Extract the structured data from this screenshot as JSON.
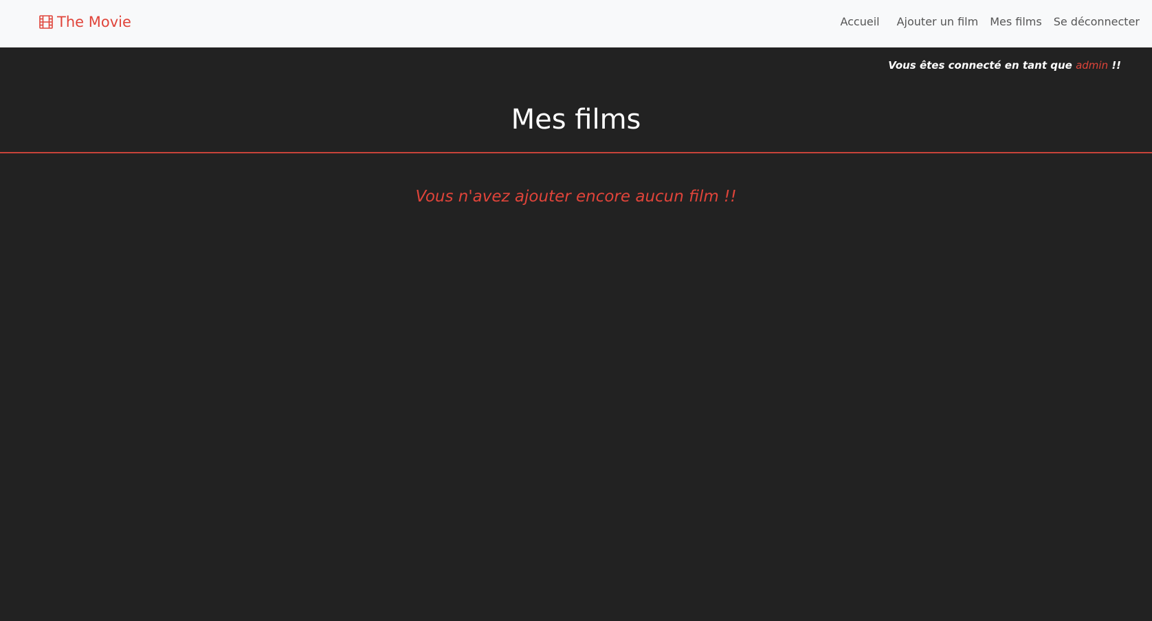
{
  "navbar": {
    "brand": {
      "icon": "film-icon",
      "label": "The Movie"
    },
    "links": [
      {
        "label": "Accueil"
      },
      {
        "label": "Ajouter un film"
      },
      {
        "label": "Mes films"
      },
      {
        "label": "Se déconnecter"
      }
    ]
  },
  "user_status": {
    "prefix": "Vous êtes connecté en tant que",
    "username": "admin",
    "suffix": "!!"
  },
  "main": {
    "title": "Mes films",
    "empty_message": "Vous n'avez ajouter encore aucun film !!"
  },
  "colors": {
    "accent": "#e0443a",
    "background": "#222222",
    "navbar": "#f8f9fa"
  }
}
